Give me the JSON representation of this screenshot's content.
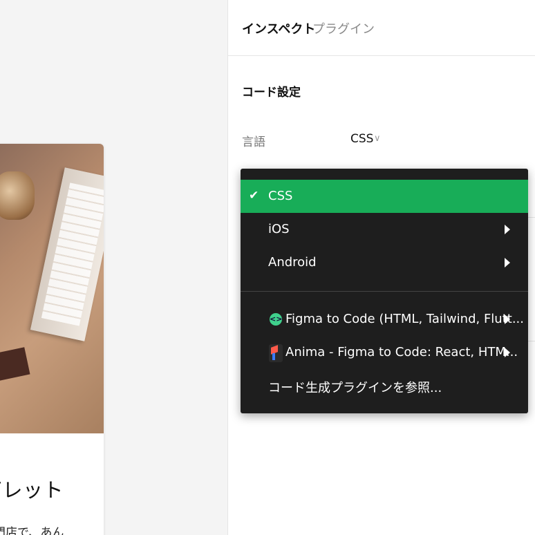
{
  "canvas": {
    "card_title": "ガレット",
    "card_desc": "専門店で、あん"
  },
  "panel": {
    "tabs": [
      {
        "label": "インスペクト"
      },
      {
        "label": "プラグイン"
      }
    ],
    "section_title": "コード設定",
    "language_label": "言語",
    "language_value": "CSS"
  },
  "menu": {
    "items": [
      {
        "label": "CSS",
        "selected": true,
        "check": "✔"
      },
      {
        "label": "iOS"
      },
      {
        "label": "Android"
      }
    ],
    "plugins": [
      {
        "label": "Figma to Code (HTML, Tailwind, Flutt...",
        "icon": "figma-to-code-icon"
      },
      {
        "label": "Anima - Figma to Code: React, HTM...",
        "icon": "anima-icon"
      }
    ],
    "browse_label": "コード生成プラグインを参照...",
    "selected_color": "#18ad58"
  }
}
